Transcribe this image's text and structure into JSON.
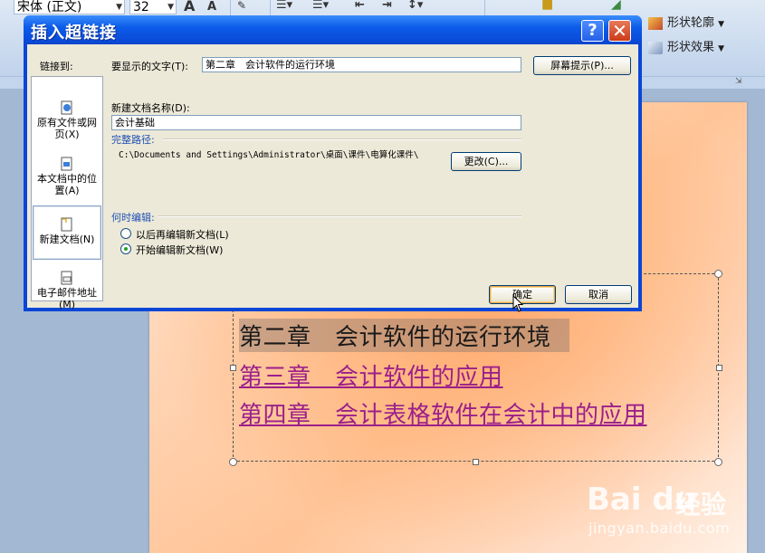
{
  "ribbon": {
    "font_name": "宋体 (正文)",
    "font_size": "32",
    "shape_outline": "形状轮廓",
    "shape_effect": "形状效果"
  },
  "slide": {
    "line1": "第二章　会计软件的运行环境",
    "line2": "第三章　会计软件的应用",
    "line3": "第四章　会计表格软件在会计中的应用"
  },
  "watermark": {
    "logo": "Bai du",
    "cn": "经验",
    "url": "jingyan.baidu.com"
  },
  "dialog": {
    "title": "插入超链接",
    "help": "?",
    "close": "✕",
    "link_to_label": "链接到:",
    "link_items": [
      {
        "label": "原有文件或网页(X)"
      },
      {
        "label": "本文档中的位置(A)"
      },
      {
        "label": "新建文档(N)"
      },
      {
        "label": "电子邮件地址(M)"
      }
    ],
    "display_text_label": "要显示的文字(T):",
    "display_text_value": "第二章　会计软件的运行环境",
    "screentip_button": "屏幕提示(P)...",
    "new_doc_name_label": "新建文档名称(D):",
    "new_doc_name_value": "会计基础",
    "full_path_label": "完整路径:",
    "full_path_value": "C:\\Documents and Settings\\Administrator\\桌面\\课件\\电算化课件\\",
    "change_button": "更改(C)...",
    "when_edit_label": "何时编辑:",
    "radio_later": "以后再编辑新文档(L)",
    "radio_now": "开始编辑新文档(W)",
    "ok_button": "确定",
    "cancel_button": "取消"
  },
  "colors": {
    "titlebar": "#0a4ad8",
    "dialog_bg": "#ece9d8",
    "hyperlink": "#9b1f8a",
    "section_label": "#1f50b4"
  }
}
